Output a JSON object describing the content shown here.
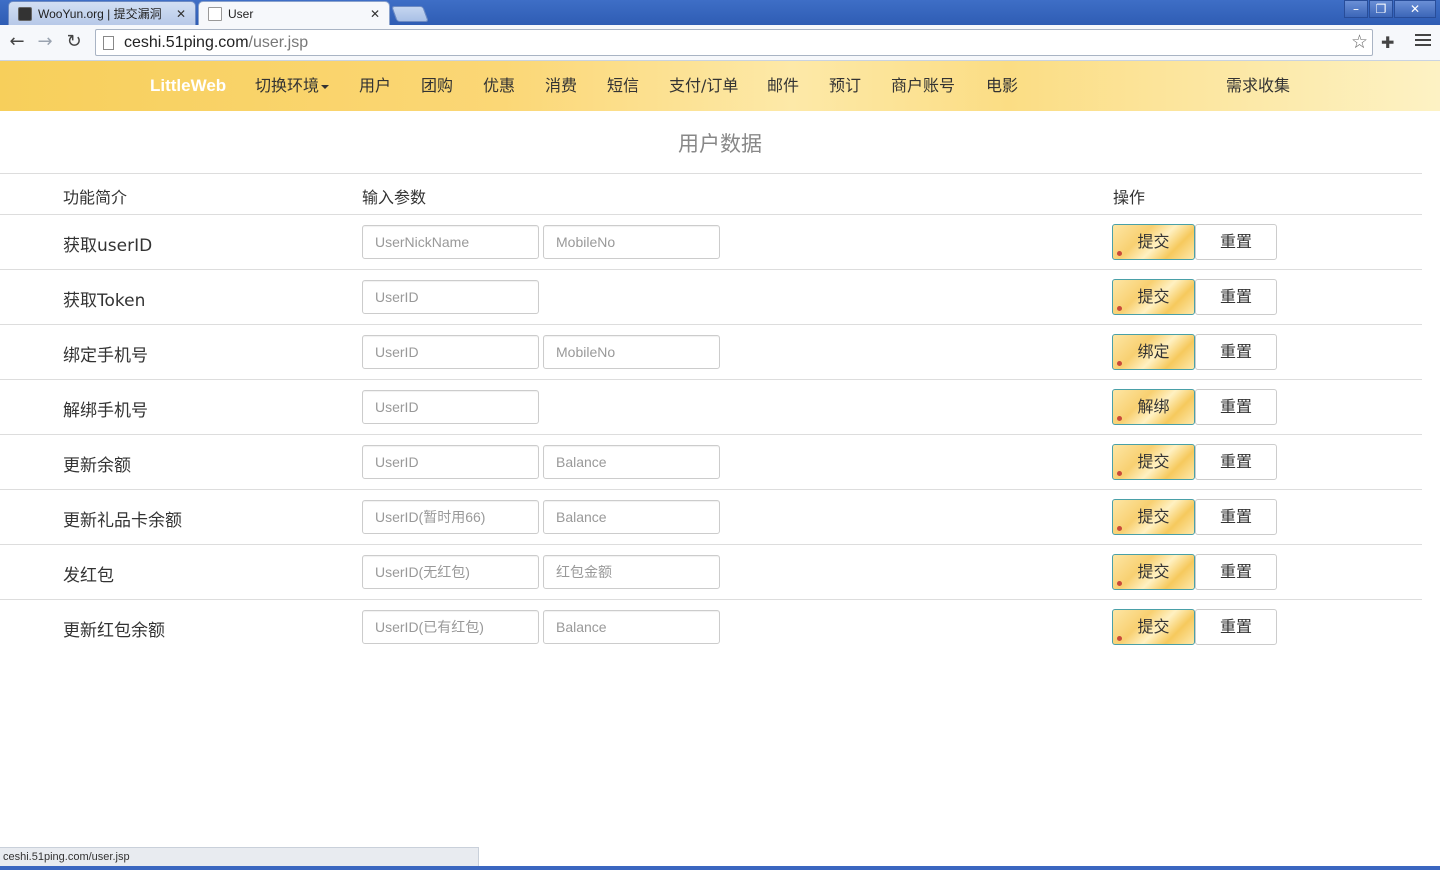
{
  "browser": {
    "tabs": [
      {
        "title": "WooYun.org | 提交漏洞"
      },
      {
        "title": "User"
      }
    ],
    "url_host": "ceshi.51ping.com",
    "url_path": "/user.jsp",
    "status_text": "ceshi.51ping.com/user.jsp"
  },
  "navbar": {
    "brand": "LittleWeb",
    "items": [
      "切换环境",
      "用户",
      "团购",
      "优惠",
      "消费",
      "短信",
      "支付/订单",
      "邮件",
      "预订",
      "商户账号",
      "电影"
    ],
    "right_item": "需求收集"
  },
  "page": {
    "title": "用户数据",
    "headers": {
      "feature": "功能简介",
      "params": "输入参数",
      "action": "操作"
    },
    "rows": [
      {
        "label": "获取userID",
        "inputs": [
          "UserNickName",
          "MobileNo"
        ],
        "submit": "提交",
        "reset": "重置"
      },
      {
        "label": "获取Token",
        "inputs": [
          "UserID"
        ],
        "submit": "提交",
        "reset": "重置"
      },
      {
        "label": "绑定手机号",
        "inputs": [
          "UserID",
          "MobileNo"
        ],
        "submit": "绑定",
        "reset": "重置"
      },
      {
        "label": "解绑手机号",
        "inputs": [
          "UserID"
        ],
        "submit": "解绑",
        "reset": "重置"
      },
      {
        "label": "更新余额",
        "inputs": [
          "UserID",
          "Balance"
        ],
        "submit": "提交",
        "reset": "重置"
      },
      {
        "label": "更新礼品卡余额",
        "inputs": [
          "UserID(暂时用66)",
          "Balance"
        ],
        "submit": "提交",
        "reset": "重置"
      },
      {
        "label": "发红包",
        "inputs": [
          "UserID(无红包)",
          "红包金额"
        ],
        "submit": "提交",
        "reset": "重置"
      },
      {
        "label": "更新红包余额",
        "inputs": [
          "UserID(已有红包)",
          "Balance"
        ],
        "submit": "提交",
        "reset": "重置"
      }
    ]
  },
  "colors": {
    "navbar_gold": "#f7cf5b",
    "brand_text": "#ffffff",
    "submit_border": "#4aa0a8"
  }
}
